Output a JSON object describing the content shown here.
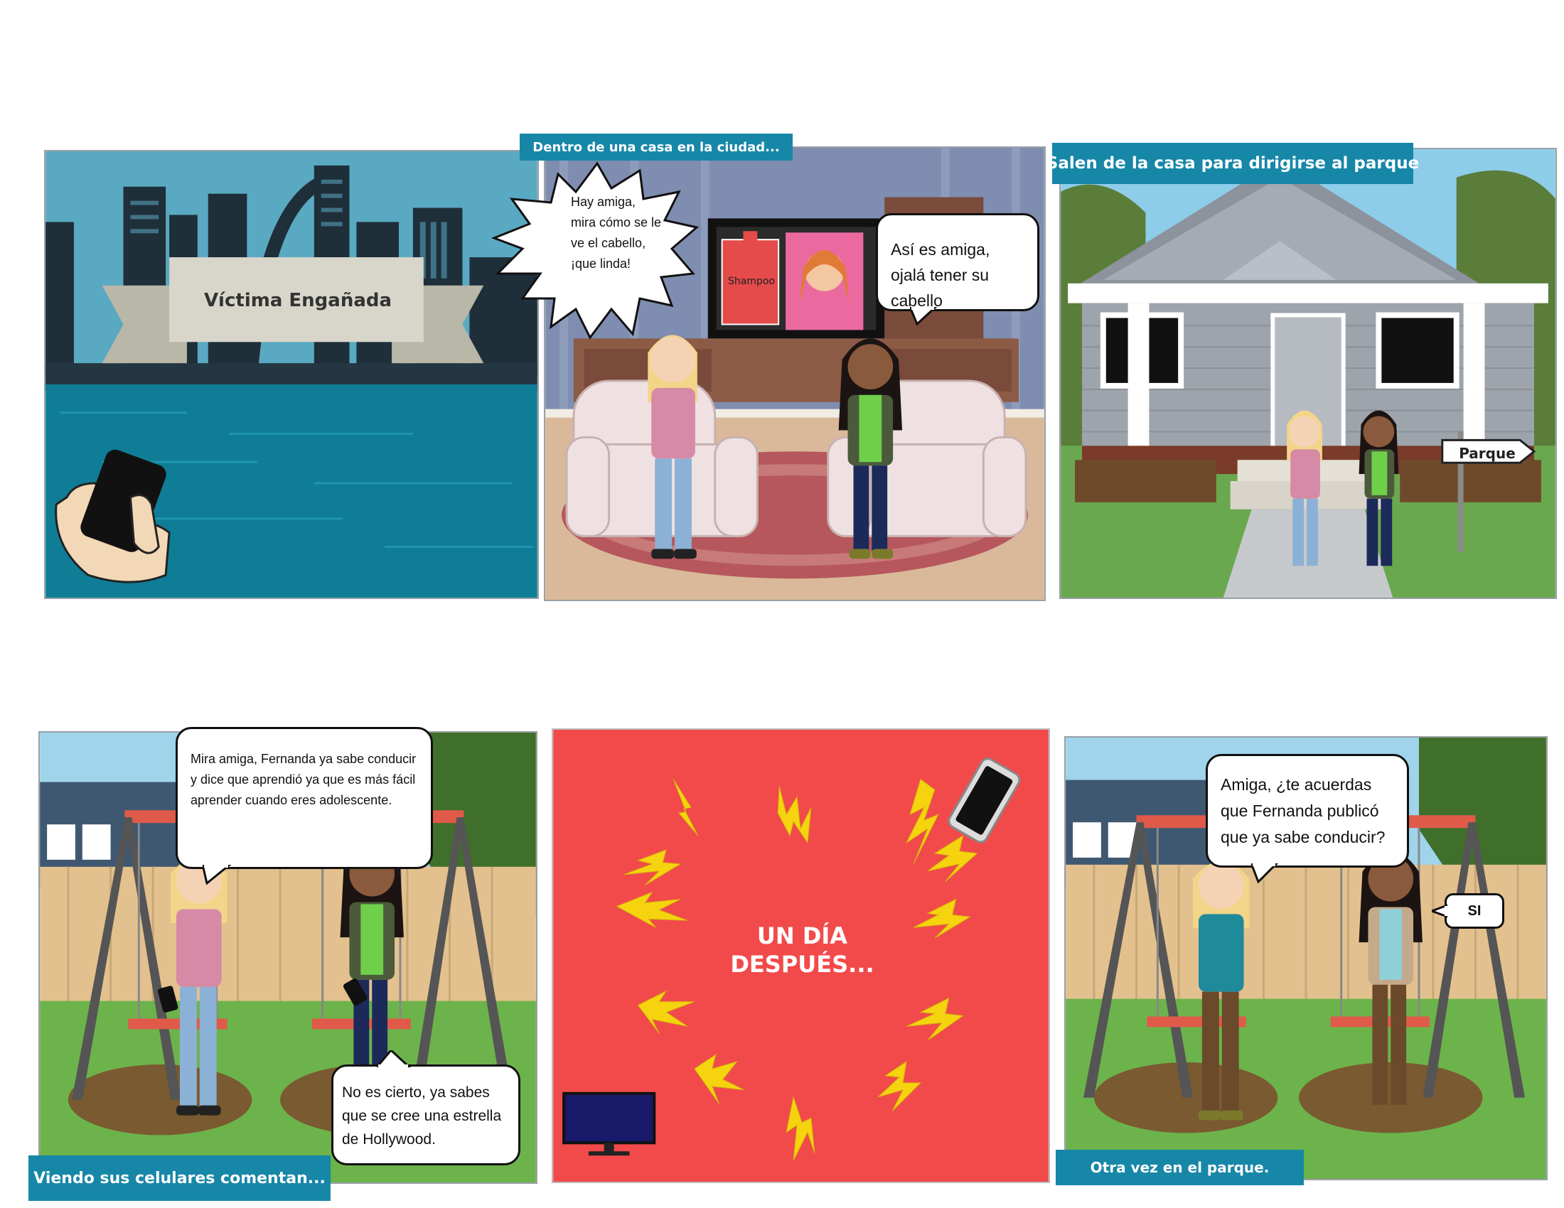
{
  "panel1": {
    "banner_title": "Víctima Engañada"
  },
  "panel2": {
    "caption": "Dentro de una casa en la ciudad...",
    "bubble_left": "Hay amiga, mira cómo se le ve el cabello, ¡que linda!",
    "bubble_right": "Así es amiga, ojalá tener su cabello",
    "tv_product": "Shampoo"
  },
  "panel3": {
    "caption": "Salen de la casa para dirigirse al parque",
    "sign": "Parque"
  },
  "panel4": {
    "bubble_top": "Mira amiga, Fernanda ya sabe conducir y dice que aprendió ya que es más fácil aprender cuando eres adolescente.",
    "bubble_bottom": "No es cierto, ya sabes que se cree una estrella de Hollywood.",
    "caption": "Viendo sus celulares comentan..."
  },
  "panel5": {
    "title_line1": "UN DÍA",
    "title_line2": "DESPUÉS..."
  },
  "panel6": {
    "bubble_top": "Amiga, ¿te acuerdas que Fernanda publicó que ya sabe conducir?",
    "bubble_right": "SI",
    "caption": "Otra vez en el parque."
  },
  "colors": {
    "caption_bg": "#1787a8",
    "panel5_bg": "#f24a4a",
    "burst_yellow": "#f5d40f"
  }
}
